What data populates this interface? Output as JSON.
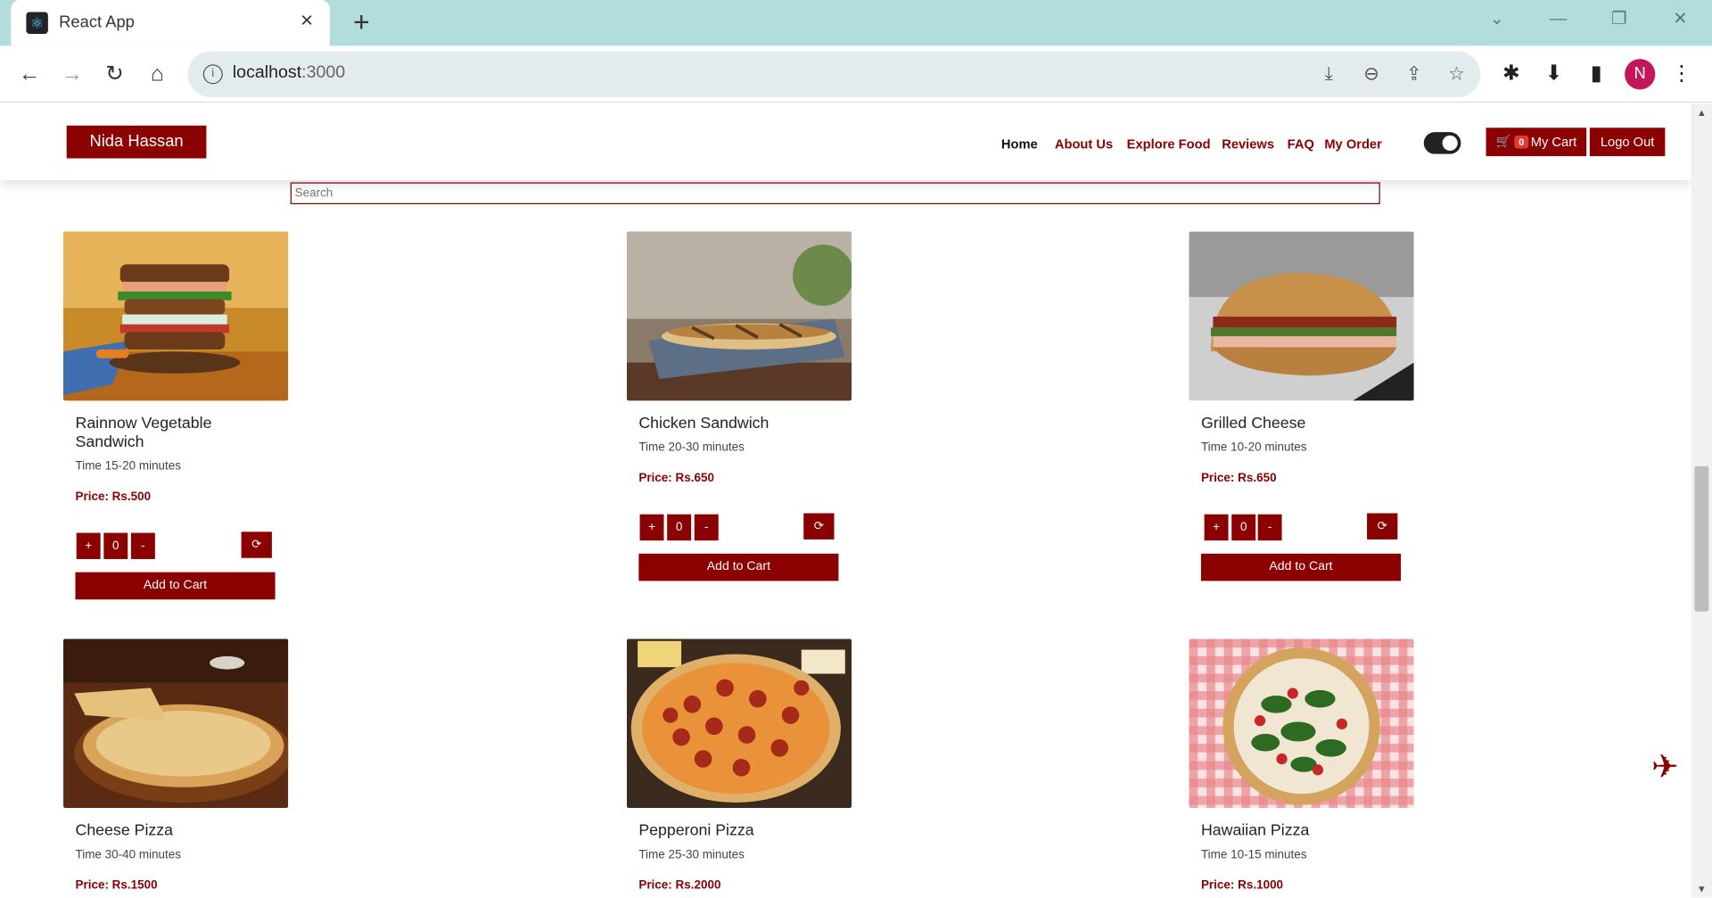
{
  "browser": {
    "tab_title": "React App",
    "url_host": "localhost",
    "url_port": ":3000",
    "profile_initial": "N"
  },
  "navbar": {
    "brand": "Nida Hassan",
    "menu": [
      "Home",
      "About Us",
      "Explore Food",
      "Reviews",
      "FAQ",
      "My Order"
    ],
    "cart_count": "0",
    "cart_label": "My Cart",
    "logout": "Logo Out"
  },
  "search": {
    "placeholder": "Search"
  },
  "products": [
    {
      "name": "Rainnow Vegetable Sandwich",
      "time": "Time 15-20 minutes",
      "price": "Price: Rs.500",
      "qty": "0",
      "add": "Add to Cart"
    },
    {
      "name": "Chicken Sandwich",
      "time": "Time 20-30 minutes",
      "price": "Price: Rs.650",
      "qty": "0",
      "add": "Add to Cart"
    },
    {
      "name": "Grilled Cheese",
      "time": "Time 10-20 minutes",
      "price": "Price: Rs.650",
      "qty": "0",
      "add": "Add to Cart"
    },
    {
      "name": "Cheese Pizza",
      "time": "Time 30-40 minutes",
      "price": "Price: Rs.1500"
    },
    {
      "name": "Pepperoni Pizza",
      "time": "Time 25-30 minutes",
      "price": "Price: Rs.2000"
    },
    {
      "name": "Hawaiian Pizza",
      "time": "Time 10-15 minutes",
      "price": "Price: Rs.1000"
    }
  ],
  "controls": {
    "plus": "+",
    "minus": "-"
  },
  "colors": {
    "brand": "#8b0000",
    "tabbar": "#b3dcdc"
  }
}
